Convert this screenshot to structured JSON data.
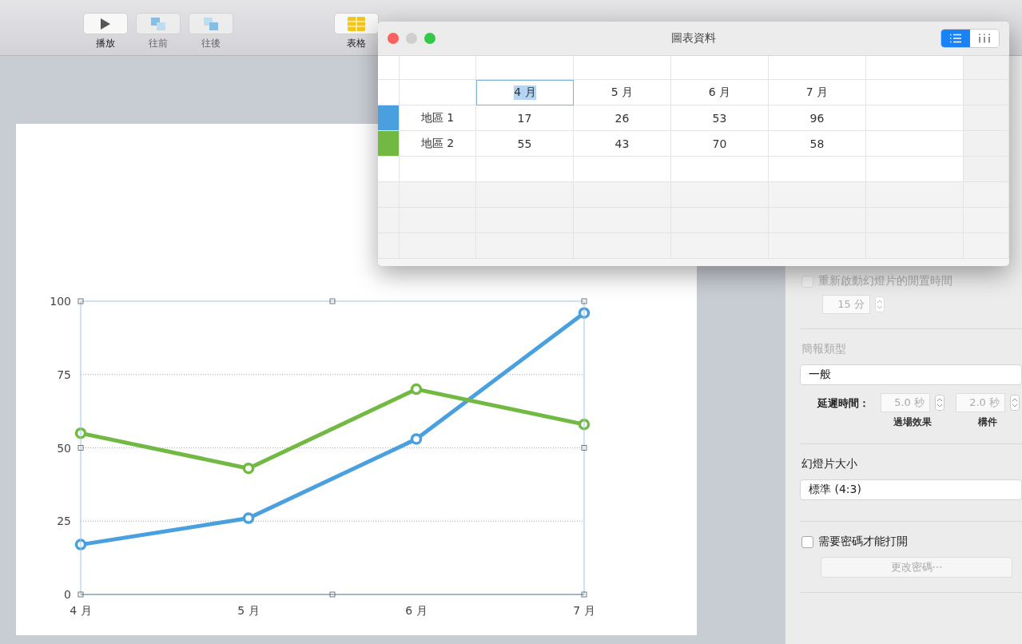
{
  "toolbar": [
    {
      "label": "播放",
      "kind": "play",
      "disabled": false
    },
    {
      "label": "往前",
      "kind": "front",
      "disabled": true
    },
    {
      "label": "往後",
      "kind": "back",
      "disabled": true
    },
    {
      "label": "表格",
      "kind": "table",
      "disabled": false
    }
  ],
  "slide": {
    "chart_data": {
      "type": "line",
      "grid": true,
      "categories": [
        "4 月",
        "5 月",
        "6 月",
        "7 月"
      ],
      "ylim": [
        0,
        100
      ],
      "yticks": [
        0,
        25,
        50,
        75,
        100
      ],
      "series": [
        {
          "color": "#4a9fdf",
          "marker": "circle",
          "values": [
            17,
            26,
            53,
            96
          ]
        },
        {
          "color": "#72b943",
          "marker": "circle",
          "values": [
            55,
            43,
            70,
            58
          ]
        }
      ]
    }
  },
  "chart_data_window": {
    "title": "圖表資料",
    "view_toggle": [
      {
        "kind": "rows",
        "selected": true
      },
      {
        "kind": "columns",
        "selected": false
      }
    ],
    "columns": [
      {
        "label": "4 月",
        "selected": true
      },
      {
        "label": "5 月",
        "selected": false
      },
      {
        "label": "6 月",
        "selected": false
      },
      {
        "label": "7 月",
        "selected": false
      }
    ],
    "rows": [
      {
        "name": "地區 1",
        "color": "#4a9fdf",
        "values": [
          "17",
          "26",
          "53",
          "96"
        ]
      },
      {
        "name": "地區 2",
        "color": "#72b943",
        "values": [
          "55",
          "43",
          "70",
          "58"
        ]
      }
    ]
  },
  "inspector": {
    "idle_restart": {
      "label": "重新啟動幻燈片的閒置時間",
      "checked": false,
      "disabled": true,
      "value": "15 分"
    },
    "presentation_type": {
      "heading": "簡報類型",
      "value": "一般",
      "delay_label": "延遲時間：",
      "delays": [
        {
          "value": "5.0 秒",
          "caption": "過場效果"
        },
        {
          "value": "2.0 秒",
          "caption": "構件"
        }
      ]
    },
    "slide_size": {
      "heading": "幻燈片大小",
      "value": "標準 (4:3)"
    },
    "password": {
      "label": "需要密碼才能打開",
      "checked": false,
      "button": "更改密碼⋯",
      "button_disabled": true
    }
  }
}
